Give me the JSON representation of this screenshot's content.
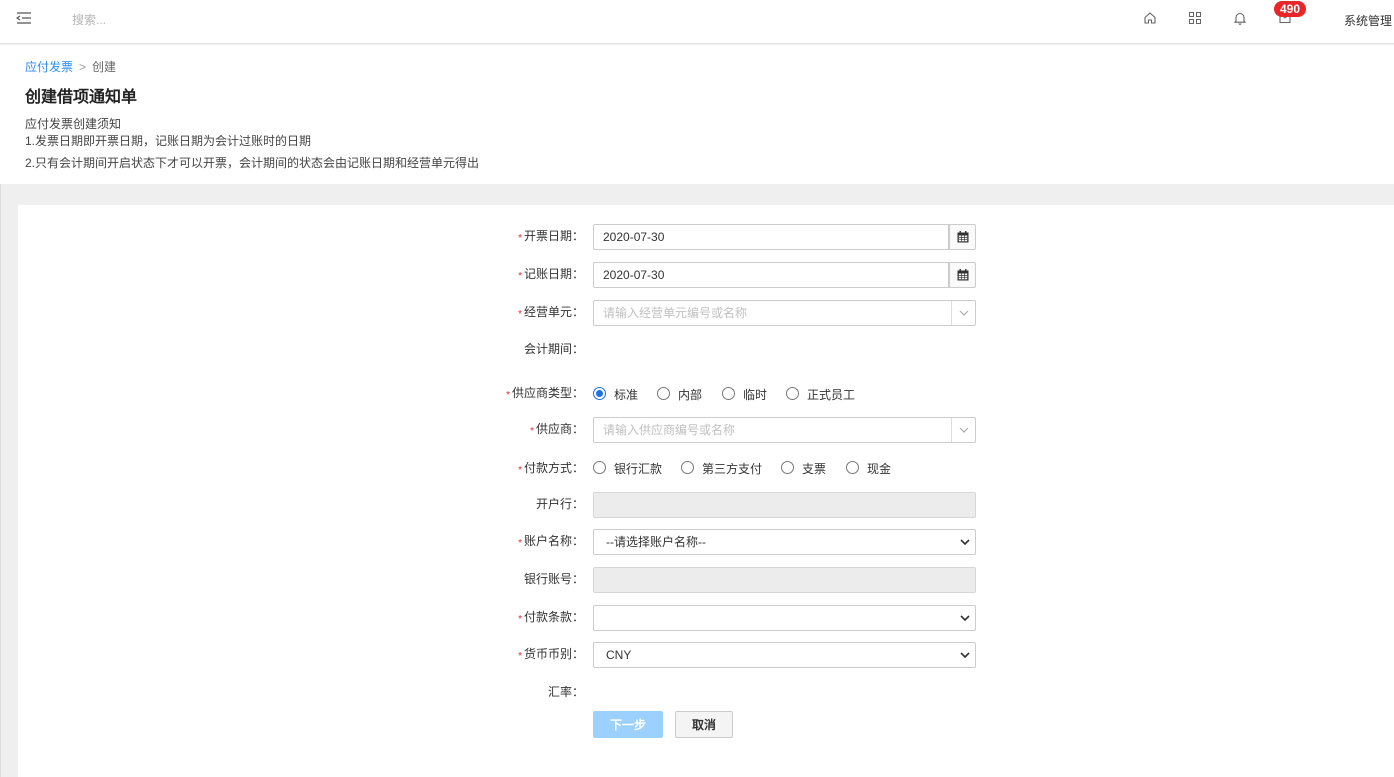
{
  "topbar": {
    "search_placeholder": "搜索...",
    "icons": [
      "menu-icon",
      "home-icon",
      "grid-icon",
      "bell-icon",
      "message-icon"
    ],
    "badge_count": "490",
    "system_menu": "系统管理",
    "badge_color": "#e8262a"
  },
  "breadcrumb": {
    "parent": "应付发票",
    "separator": ">",
    "current": "创建"
  },
  "page_title": "创建借项通知单",
  "notice": {
    "heading": "应付发票创建须知",
    "line1": "1.发票日期即开票日期，记账日期为会计过账时的日期",
    "line2": "2.只有会计期间开启状态下才可以开票，会计期间的状态会由记账日期和经营单元得出"
  },
  "form": {
    "required_mark": "*",
    "invoice_date": {
      "label": "开票日期：",
      "value": "2020-07-30"
    },
    "posting_date": {
      "label": "记账日期：",
      "value": "2020-07-30"
    },
    "business_unit": {
      "label": "经营单元：",
      "placeholder": "请输入经营单元编号或名称"
    },
    "accounting_period": {
      "label": "会计期间：",
      "value": ""
    },
    "supplier_type": {
      "label": "供应商类型：",
      "options": [
        "标准",
        "内部",
        "临时",
        "正式员工"
      ],
      "selected": "标准"
    },
    "supplier": {
      "label": "供应商：",
      "placeholder": "请输入供应商编号或名称"
    },
    "payment_method": {
      "label": "付款方式：",
      "options": [
        "银行汇款",
        "第三方支付",
        "支票",
        "现金"
      ],
      "selected": ""
    },
    "bank": {
      "label": "开户行：",
      "value": ""
    },
    "account_name": {
      "label": "账户名称：",
      "value": "--请选择账户名称--"
    },
    "bank_account": {
      "label": "银行账号：",
      "value": ""
    },
    "payment_terms": {
      "label": "付款条款：",
      "value": ""
    },
    "currency": {
      "label": "货币币别：",
      "value": "CNY"
    },
    "exchange_rate": {
      "label": "汇率：",
      "value": ""
    },
    "next_button": "下一步",
    "cancel_button": "取消",
    "accent_color": "#1a73e8"
  }
}
